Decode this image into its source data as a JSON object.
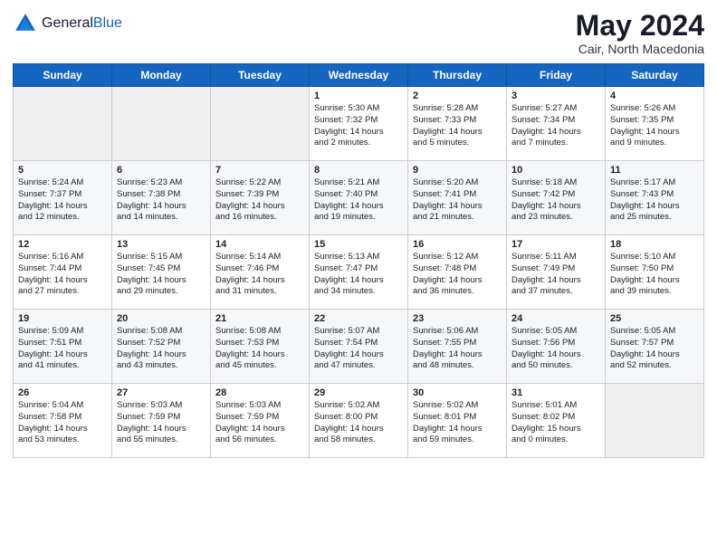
{
  "header": {
    "logo_general": "General",
    "logo_blue": "Blue",
    "month_title": "May 2024",
    "location": "Cair, North Macedonia"
  },
  "weekdays": [
    "Sunday",
    "Monday",
    "Tuesday",
    "Wednesday",
    "Thursday",
    "Friday",
    "Saturday"
  ],
  "weeks": [
    [
      {
        "day": "",
        "info": ""
      },
      {
        "day": "",
        "info": ""
      },
      {
        "day": "",
        "info": ""
      },
      {
        "day": "1",
        "info": "Sunrise: 5:30 AM\nSunset: 7:32 PM\nDaylight: 14 hours\nand 2 minutes."
      },
      {
        "day": "2",
        "info": "Sunrise: 5:28 AM\nSunset: 7:33 PM\nDaylight: 14 hours\nand 5 minutes."
      },
      {
        "day": "3",
        "info": "Sunrise: 5:27 AM\nSunset: 7:34 PM\nDaylight: 14 hours\nand 7 minutes."
      },
      {
        "day": "4",
        "info": "Sunrise: 5:26 AM\nSunset: 7:35 PM\nDaylight: 14 hours\nand 9 minutes."
      }
    ],
    [
      {
        "day": "5",
        "info": "Sunrise: 5:24 AM\nSunset: 7:37 PM\nDaylight: 14 hours\nand 12 minutes."
      },
      {
        "day": "6",
        "info": "Sunrise: 5:23 AM\nSunset: 7:38 PM\nDaylight: 14 hours\nand 14 minutes."
      },
      {
        "day": "7",
        "info": "Sunrise: 5:22 AM\nSunset: 7:39 PM\nDaylight: 14 hours\nand 16 minutes."
      },
      {
        "day": "8",
        "info": "Sunrise: 5:21 AM\nSunset: 7:40 PM\nDaylight: 14 hours\nand 19 minutes."
      },
      {
        "day": "9",
        "info": "Sunrise: 5:20 AM\nSunset: 7:41 PM\nDaylight: 14 hours\nand 21 minutes."
      },
      {
        "day": "10",
        "info": "Sunrise: 5:18 AM\nSunset: 7:42 PM\nDaylight: 14 hours\nand 23 minutes."
      },
      {
        "day": "11",
        "info": "Sunrise: 5:17 AM\nSunset: 7:43 PM\nDaylight: 14 hours\nand 25 minutes."
      }
    ],
    [
      {
        "day": "12",
        "info": "Sunrise: 5:16 AM\nSunset: 7:44 PM\nDaylight: 14 hours\nand 27 minutes."
      },
      {
        "day": "13",
        "info": "Sunrise: 5:15 AM\nSunset: 7:45 PM\nDaylight: 14 hours\nand 29 minutes."
      },
      {
        "day": "14",
        "info": "Sunrise: 5:14 AM\nSunset: 7:46 PM\nDaylight: 14 hours\nand 31 minutes."
      },
      {
        "day": "15",
        "info": "Sunrise: 5:13 AM\nSunset: 7:47 PM\nDaylight: 14 hours\nand 34 minutes."
      },
      {
        "day": "16",
        "info": "Sunrise: 5:12 AM\nSunset: 7:48 PM\nDaylight: 14 hours\nand 36 minutes."
      },
      {
        "day": "17",
        "info": "Sunrise: 5:11 AM\nSunset: 7:49 PM\nDaylight: 14 hours\nand 37 minutes."
      },
      {
        "day": "18",
        "info": "Sunrise: 5:10 AM\nSunset: 7:50 PM\nDaylight: 14 hours\nand 39 minutes."
      }
    ],
    [
      {
        "day": "19",
        "info": "Sunrise: 5:09 AM\nSunset: 7:51 PM\nDaylight: 14 hours\nand 41 minutes."
      },
      {
        "day": "20",
        "info": "Sunrise: 5:08 AM\nSunset: 7:52 PM\nDaylight: 14 hours\nand 43 minutes."
      },
      {
        "day": "21",
        "info": "Sunrise: 5:08 AM\nSunset: 7:53 PM\nDaylight: 14 hours\nand 45 minutes."
      },
      {
        "day": "22",
        "info": "Sunrise: 5:07 AM\nSunset: 7:54 PM\nDaylight: 14 hours\nand 47 minutes."
      },
      {
        "day": "23",
        "info": "Sunrise: 5:06 AM\nSunset: 7:55 PM\nDaylight: 14 hours\nand 48 minutes."
      },
      {
        "day": "24",
        "info": "Sunrise: 5:05 AM\nSunset: 7:56 PM\nDaylight: 14 hours\nand 50 minutes."
      },
      {
        "day": "25",
        "info": "Sunrise: 5:05 AM\nSunset: 7:57 PM\nDaylight: 14 hours\nand 52 minutes."
      }
    ],
    [
      {
        "day": "26",
        "info": "Sunrise: 5:04 AM\nSunset: 7:58 PM\nDaylight: 14 hours\nand 53 minutes."
      },
      {
        "day": "27",
        "info": "Sunrise: 5:03 AM\nSunset: 7:59 PM\nDaylight: 14 hours\nand 55 minutes."
      },
      {
        "day": "28",
        "info": "Sunrise: 5:03 AM\nSunset: 7:59 PM\nDaylight: 14 hours\nand 56 minutes."
      },
      {
        "day": "29",
        "info": "Sunrise: 5:02 AM\nSunset: 8:00 PM\nDaylight: 14 hours\nand 58 minutes."
      },
      {
        "day": "30",
        "info": "Sunrise: 5:02 AM\nSunset: 8:01 PM\nDaylight: 14 hours\nand 59 minutes."
      },
      {
        "day": "31",
        "info": "Sunrise: 5:01 AM\nSunset: 8:02 PM\nDaylight: 15 hours\nand 0 minutes."
      },
      {
        "day": "",
        "info": ""
      }
    ]
  ]
}
